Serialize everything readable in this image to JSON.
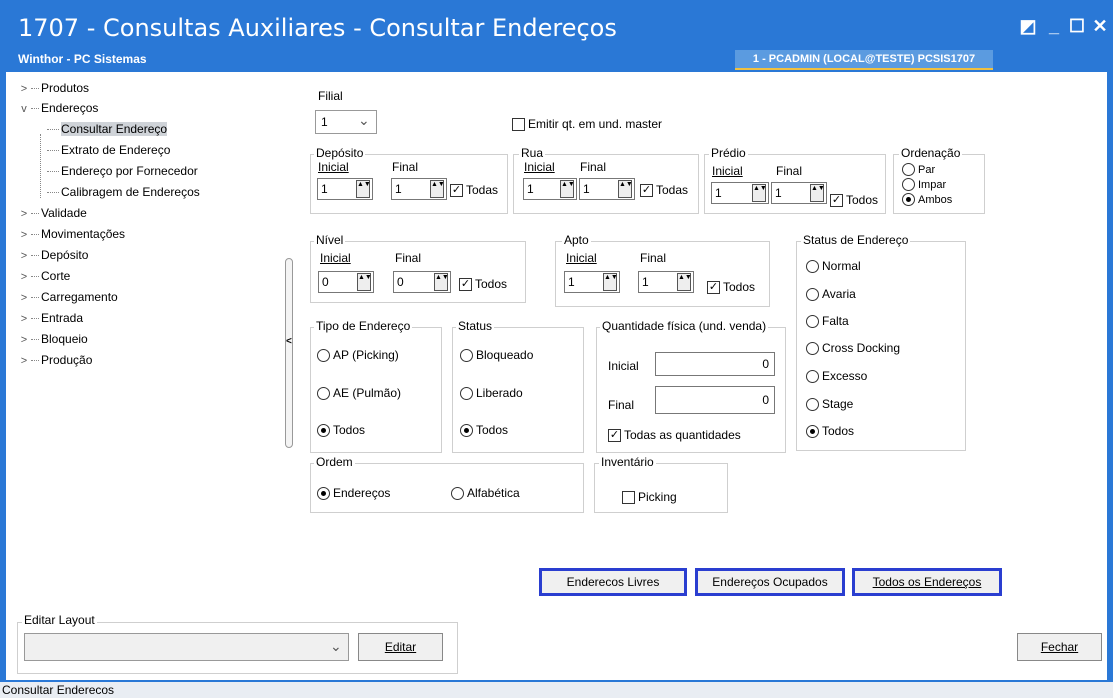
{
  "window": {
    "title": "1707 - Consultas Auxiliares - Consultar Endereços",
    "subtitle": "Winthor - PC Sistemas",
    "user": "1 - PCADMIN (LOCAL@TESTE)  PCSIS1707",
    "btn_restore": "◩",
    "btn_min": "_",
    "btn_max": "☐",
    "btn_close": "✕"
  },
  "tree": {
    "items": [
      {
        "label": "Produtos",
        "arrow": ">"
      },
      {
        "label": "Endereços",
        "arrow": "v"
      },
      {
        "label": "Consultar Endereço"
      },
      {
        "label": "Extrato de Endereço"
      },
      {
        "label": "Endereço por Fornecedor"
      },
      {
        "label": "Calibragem de Endereços"
      },
      {
        "label": "Validade",
        "arrow": ">"
      },
      {
        "label": "Movimentações",
        "arrow": ">"
      },
      {
        "label": "Depósito",
        "arrow": ">"
      },
      {
        "label": "Corte",
        "arrow": ">"
      },
      {
        "label": "Carregamento",
        "arrow": ">"
      },
      {
        "label": "Entrada",
        "arrow": ">"
      },
      {
        "label": "Bloqueio",
        "arrow": ">"
      },
      {
        "label": "Produção",
        "arrow": ">"
      }
    ]
  },
  "filial": {
    "label": "Filial",
    "value": "1",
    "chev": "⌄"
  },
  "master": {
    "label": "Emitir qt. em und. master"
  },
  "deposito": {
    "label": "Depósito",
    "inicial": "Inicial",
    "final": "Final",
    "v1": "1",
    "v2": "1",
    "todas": "Todas"
  },
  "rua": {
    "label": "Rua",
    "inicial": "Inicial",
    "final": "Final",
    "v1": "1",
    "v2": "1",
    "todas": "Todas"
  },
  "predio": {
    "label": "Prédio",
    "inicial": "Inicial",
    "final": "Final",
    "v1": "1",
    "v2": "1",
    "todos": "Todos"
  },
  "ordenacao": {
    "label": "Ordenação",
    "par": "Par",
    "impar": "Impar",
    "ambos": "Ambos"
  },
  "nivel": {
    "label": "Nível",
    "inicial": "Inicial",
    "final": "Final",
    "v1": "0",
    "v2": "0",
    "todos": "Todos"
  },
  "apto": {
    "label": "Apto",
    "inicial": "Inicial",
    "final": "Final",
    "v1": "1",
    "v2": "1",
    "todos": "Todos"
  },
  "status_end": {
    "label": "Status de Endereço",
    "options": [
      "Normal",
      "Avaria",
      "Falta",
      "Cross Docking",
      "Excesso",
      "Stage",
      "Todos"
    ]
  },
  "tipo": {
    "label": "Tipo de Endereço",
    "options": [
      "AP (Picking)",
      "AE (Pulmão)",
      "Todos"
    ]
  },
  "status": {
    "label": "Status",
    "options": [
      "Bloqueado",
      "Liberado",
      "Todos"
    ]
  },
  "qtd": {
    "label": "Quantidade física (und. venda)",
    "inicial": "Inicial",
    "final": "Final",
    "v1": "0",
    "v2": "0",
    "todas": "Todas as quantidades"
  },
  "ordem": {
    "label": "Ordem",
    "enderecos": "Endereços",
    "alfabetica": "Alfabética"
  },
  "inventario": {
    "label": "Inventário",
    "picking": "Picking"
  },
  "buttons": {
    "livres": "Enderecos Livres",
    "ocupados": "Endereços Ocupados",
    "todos": "Todos os Endereços",
    "editar": "Editar",
    "fechar": "Fechar"
  },
  "layout": {
    "label": "Editar Layout",
    "chev": "⌄"
  },
  "statusbar": {
    "text": "Consultar Enderecos"
  },
  "glyphs": {
    "check": "✓",
    "spin": "▲▼"
  }
}
